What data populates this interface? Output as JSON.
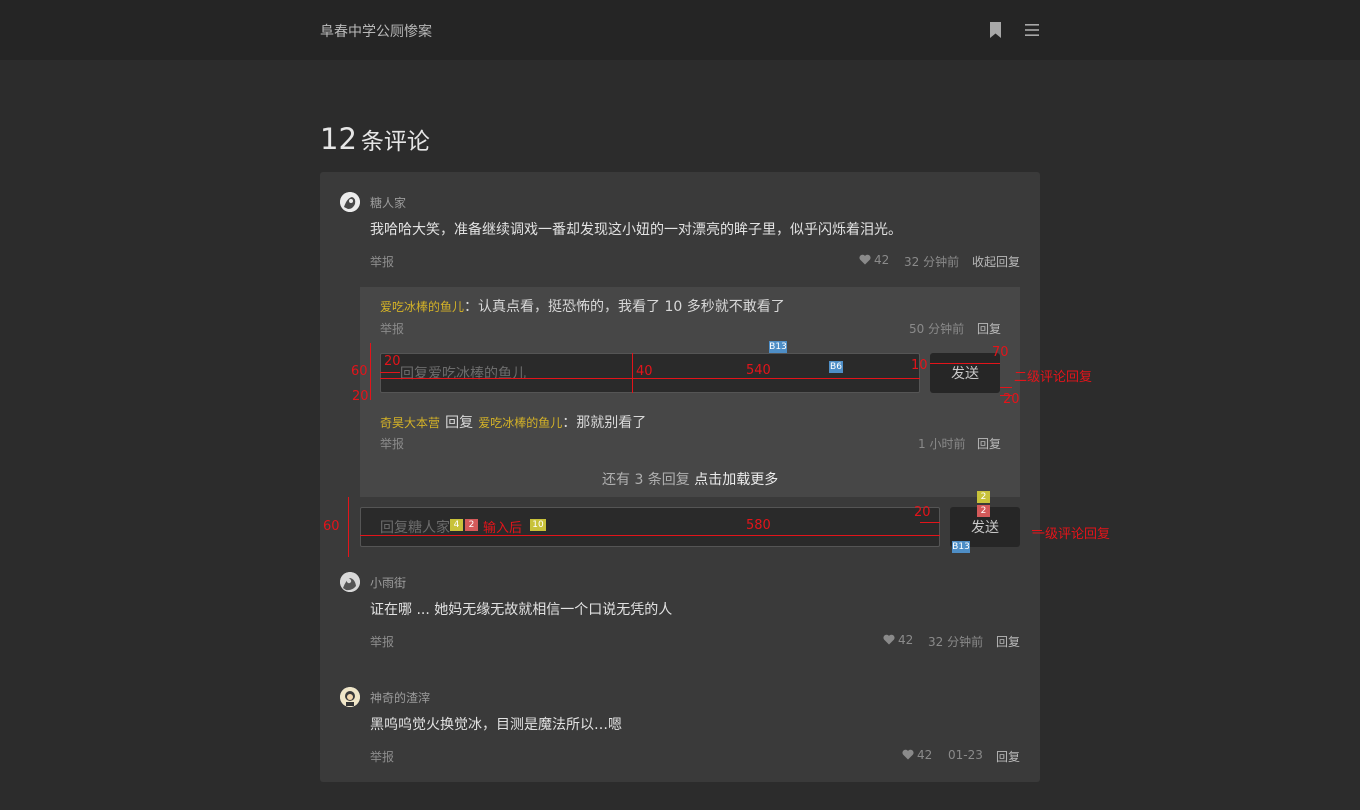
{
  "site": {
    "title": "阜春中学公厕惨案"
  },
  "icons": {
    "bookmark": "bookmark-icon",
    "menu": "menu-icon",
    "like": "heart-icon"
  },
  "comments_header": {
    "count": "12",
    "label": "条评论"
  },
  "comments": [
    {
      "user": "糖人家",
      "text": "我哈哈大笑，准备继续调戏一番却发现这小妞的一对漂亮的眸子里，似乎闪烁着泪光。",
      "report": "举报",
      "likes": "42",
      "time": "32 分钟前",
      "action": "收起回复",
      "replies": [
        {
          "user": "爱吃冰棒的鱼儿",
          "sep": "：",
          "text": "认真点看，挺恐怖的，我看了 10 多秒就不敢看了",
          "report": "举报",
          "time": "50 分钟前",
          "action": "回复",
          "input_placeholder": "回复爱吃冰棒的鱼儿",
          "send": "发送"
        },
        {
          "user": "奇昊大本营",
          "reply_word": "回复",
          "target": "爱吃冰棒的鱼儿",
          "sep": "：",
          "text": "那就别看了",
          "report": "举报",
          "time": "1 小时前",
          "action": "回复"
        }
      ],
      "load_more": {
        "prefix": "还有 3 条回复",
        "link": "点击加载更多"
      },
      "input_placeholder": "回复糖人家",
      "send": "发送"
    },
    {
      "user": "小雨街",
      "text": "证在哪 ... 她妈无缘无故就相信一个口说无凭的人",
      "report": "举报",
      "likes": "42",
      "time": "32 分钟前",
      "action": "回复"
    },
    {
      "user": "神奇的渣滓",
      "text": "黑呜呜觉火换觉冰，目测是魔法所以…嗯",
      "report": "举报",
      "likes": "42",
      "time": "01-23",
      "action": "回复"
    }
  ],
  "annotations": {
    "color": "#e3141a",
    "second_level": {
      "label": "二级评论回复",
      "n60": "60",
      "n20a": "20",
      "n20b": "20",
      "n40": "40",
      "n540": "540",
      "n10": "10",
      "n70": "70",
      "n20c": "20",
      "tag_b13": "B13",
      "tag_b6": "B6"
    },
    "first_level": {
      "label": "一级评论回复",
      "n60": "60",
      "n580": "580",
      "n20": "20",
      "after_input": "输入后",
      "tag_4": "4",
      "tag_2a": "2",
      "tag_10": "10",
      "tag_2b": "2",
      "tag_2c": "2",
      "tag_b13": "B13"
    }
  }
}
